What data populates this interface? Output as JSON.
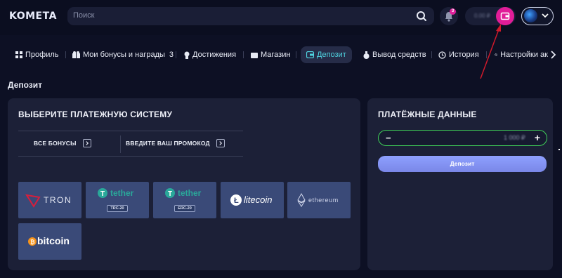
{
  "header": {
    "logo": "KOMETA",
    "search_placeholder": "Поиск",
    "notification_count": "3",
    "balance": "0.00 ₽"
  },
  "nav": {
    "items": [
      {
        "label": "Профиль",
        "icon": "grid-icon"
      },
      {
        "label": "Мои бонусы и награды",
        "count": "3",
        "icon": "gift-icon"
      },
      {
        "label": "Достижения",
        "icon": "medal-icon"
      },
      {
        "label": "Магазин",
        "icon": "shop-icon"
      },
      {
        "label": "Депозит",
        "icon": "wallet-icon",
        "active": true
      },
      {
        "label": "Вывод средств",
        "icon": "money-bag-icon"
      },
      {
        "label": "История",
        "icon": "history-icon"
      },
      {
        "label": "Настройки ак",
        "icon": "gear-icon"
      }
    ]
  },
  "page_title": "Депозит",
  "payment": {
    "title": "ВЫБЕРИТЕ ПЛАТЕЖНУЮ СИСТЕМУ",
    "filter_bonuses": "ВСЕ БОНУСЫ",
    "filter_promo": "ВВЕДИТЕ ВАШ ПРОМОКОД",
    "methods": [
      {
        "name": "TRON"
      },
      {
        "name": "tether",
        "network": "TRC-20"
      },
      {
        "name": "tether",
        "network": "ERC-20"
      },
      {
        "name": "litecoin"
      },
      {
        "name": "ethereum"
      },
      {
        "name": "bitcoin"
      }
    ]
  },
  "payment_details": {
    "title": "ПЛАТЁЖНЫЕ ДАННЫЕ",
    "amount": "1 000 ₽",
    "deposit_label": "Депозит"
  },
  "colors": {
    "accent_pink": "#e11d98",
    "accent_cyan": "#4fd3e0",
    "amount_border_green": "#3fcf58",
    "button_gradient": "#8ea0ff",
    "card_bg": "#3a4a78"
  }
}
